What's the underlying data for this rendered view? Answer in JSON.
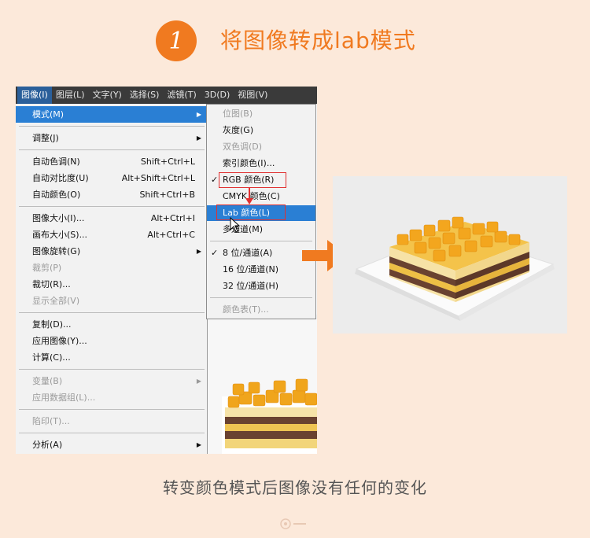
{
  "heading": {
    "step_number": "1",
    "title": "将图像转成lab模式"
  },
  "menubar": [
    "图像(I)",
    "图层(L)",
    "文字(Y)",
    "选择(S)",
    "滤镜(T)",
    "3D(D)",
    "视图(V)"
  ],
  "image_menu": {
    "mode": "模式(M)",
    "adjust": "调整(J)",
    "auto_tone": "自动色调(N)",
    "auto_tone_sc": "Shift+Ctrl+L",
    "auto_contrast": "自动对比度(U)",
    "auto_contrast_sc": "Alt+Shift+Ctrl+L",
    "auto_color": "自动颜色(O)",
    "auto_color_sc": "Shift+Ctrl+B",
    "image_size": "图像大小(I)...",
    "image_size_sc": "Alt+Ctrl+I",
    "canvas_size": "画布大小(S)...",
    "canvas_size_sc": "Alt+Ctrl+C",
    "rotation": "图像旋转(G)",
    "crop": "裁剪(P)",
    "trim": "裁切(R)...",
    "reveal_all": "显示全部(V)",
    "duplicate": "复制(D)...",
    "apply_image": "应用图像(Y)...",
    "calculations": "计算(C)...",
    "variables": "变量(B)",
    "apply_dataset": "应用数据组(L)...",
    "trap": "陷印(T)...",
    "analysis": "分析(A)"
  },
  "mode_submenu": {
    "bitmap": "位图(B)",
    "grayscale": "灰度(G)",
    "duotone": "双色调(D)",
    "indexed": "索引颜色(I)...",
    "rgb": "RGB 颜色(R)",
    "cmyk": "CMYK 颜色(C)",
    "lab": "Lab 颜色(L)",
    "multichannel": "多通道(M)",
    "bit8": "8 位/通道(A)",
    "bit16": "16 位/通道(N)",
    "bit32": "32 位/通道(H)",
    "color_table": "颜色表(T)...",
    "check": "✓"
  },
  "caption": "转变颜色模式后图像没有任何的变化",
  "colors": {
    "accent": "#f07a20",
    "highlight": "#2a7fd4",
    "background": "#fce9da",
    "menubar": "#3a3a3a"
  }
}
